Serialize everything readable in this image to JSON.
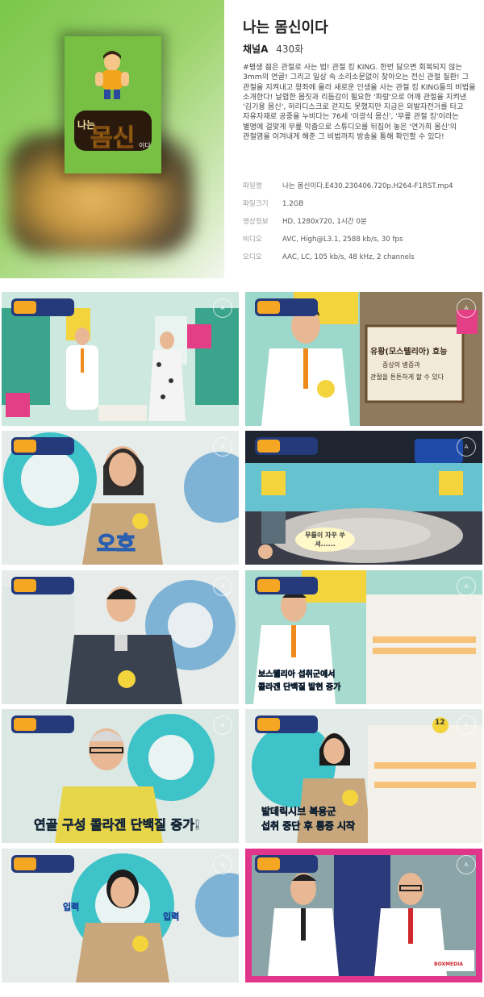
{
  "program": {
    "title": "나는 몸신이다",
    "channel": "채널A",
    "episode": "430화",
    "description": "#평생 젊은 관절로 사는 법! 관절 킹 KING. 한번 닳으면 회복되지 않는 3mm의 연골! 그리고 일상 속 소리소문없이 찾아오는 전신 관절 질환! 그 관절을 지켜내고 왕좌에 올라 새로운 인생을 사는 관절 킹 KING들의 비법을 소개한다! 날렵한 몸짓과 리듬감이 필요한 '파랑'으로 어깨 관절을 지켜낸 '김기용 몸신', 허리디스크로 걷지도 못했지만 지금은 외발자전거를 타고 자유자재로 공중을 누비다는 76세 '이광식 몸신', '무릎 관절 킹'이라는 별명에 걸맞게 무릎 막춤으로 스튜디오를 뒤집어 놓은 '연가희 몸신'의 관절염을 이겨내게 해준 그 비법까지 방송을 통해 확인할 수 있다!"
  },
  "poster": {
    "logo_text": "몸신",
    "logo_sub": "이다",
    "logo_prefix": "나는"
  },
  "file_info": [
    {
      "key": "파일명",
      "value": "나는 몸신이다.E430.230406.720p.H264-F1RST.mp4"
    },
    {
      "key": "파일크기",
      "value": "1.2GB"
    },
    {
      "key": "영상정보",
      "value": "HD, 1280x720, 1시간 0분"
    },
    {
      "key": "비디오",
      "value": "AVC, High@L3.1, 2588 kb/s, 30 fps"
    },
    {
      "key": "오디오",
      "value": "AAC, LC, 105 kb/s, 48 kHz, 2 channels"
    }
  ],
  "thumbnails": {
    "t2_board_title": "유황(모스텔리아) 효능",
    "t2_board_line1": "증상의 병증과",
    "t2_board_line2": "관절을 튼튼하게 할 수 있다",
    "t3_caption": "오호",
    "t4_speech": "무릎이 자꾸 쑤셔......",
    "t6_caption1": "보스웰리아 섭취군에서",
    "t6_caption2": "콜라겐 단백질 발현 증가",
    "t7_caption": "연골 구성 콜라겐 단백질 증가!",
    "t8_caption1": "발데릭시브 복용군",
    "t8_caption2": "섭취 중단 후 통증 시작",
    "t8_number": "12",
    "t9_left": "입력",
    "t9_right": "입력",
    "t10_brand": "BOXMEDIA"
  },
  "colors": {
    "accent": "#f08a1c",
    "channel_green": "#77c043",
    "pink": "#e0358a"
  }
}
